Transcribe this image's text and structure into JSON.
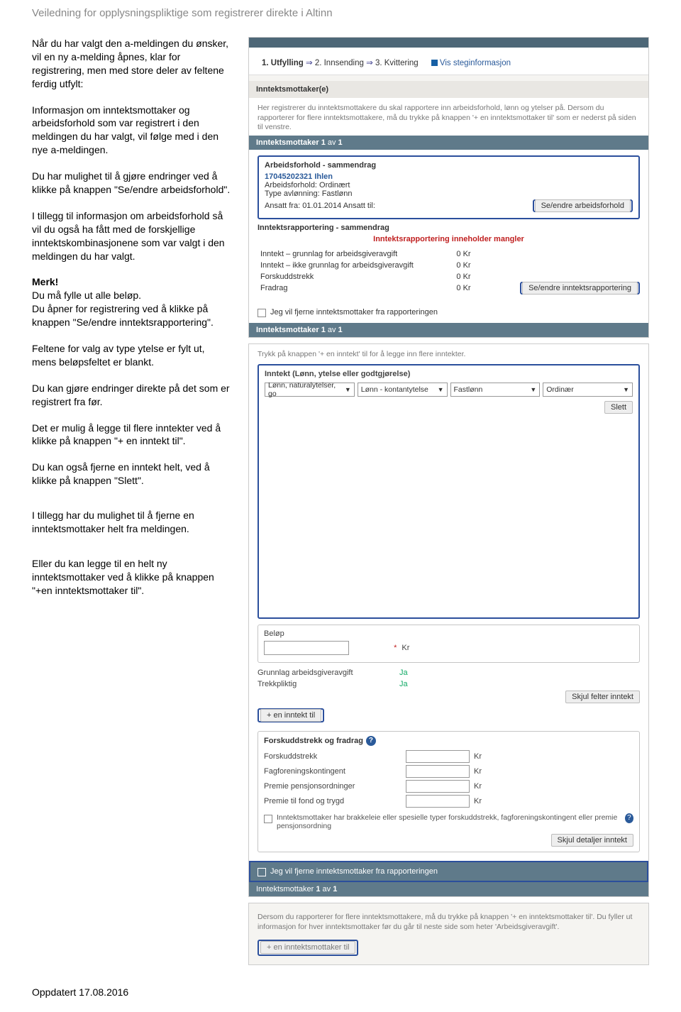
{
  "page_header": "Veiledning for opplysningspliktige som registrerer direkte i Altinn",
  "left": {
    "p1": "Når du har valgt den a-meldingen du ønsker, vil en ny a-melding åpnes, klar for registrering, men med store deler av feltene ferdig utfylt:",
    "p2": "Informasjon om inntektsmottaker og arbeidsforhold som var registrert i den meldingen du har valgt, vil følge med i den nye a-meldingen.",
    "p3": "Du har mulighet til å gjøre endringer ved å klikke på knappen \"Se/endre arbeidsforhold\".",
    "p4": "I tillegg til informasjon om arbeidsforhold så vil du også ha fått med de forskjellige inntektskombinasjonene som var valgt i den meldingen du har valgt.",
    "merk_label": "Merk!",
    "merk1": "Du må fylle ut alle beløp.",
    "merk2": "Du åpner for registrering ved å klikke på knappen \"Se/endre inntektsrapportering\".",
    "p5": "Feltene for valg av type ytelse er fylt ut, mens beløpsfeltet er blankt.",
    "p6": "Du kan gjøre endringer direkte på det som er registrert fra før.",
    "p7": "Det er mulig å legge til flere inntekter ved å klikke på knappen \"+ en inntekt til\".",
    "p8": "Du kan også fjerne en inntekt helt, ved å klikke på knappen \"Slett\".",
    "p9": "I tillegg har du mulighet til å fjerne en inntektsmottaker helt fra meldingen.",
    "p10": "Eller du kan legge til en helt ny inntektsmottaker ved å klikke på knappen \"+en inntektsmottaker til\"."
  },
  "panel1": {
    "step1": "1. Utfylling",
    "step2": "2. Innsending",
    "step3": "3. Kvittering",
    "steglink": "Vis steginformasjon",
    "section_title": "Inntektsmottaker(e)",
    "intro": "Her registrerer du inntektsmottakere du skal rapportere inn arbeidsforhold, lønn og ytelser på. Dersom du rapporterer for flere inntektsmottakere, må du trykke på knappen '+ en inntektsmottaker til' som er nederst på siden til venstre.",
    "subband_top": "Inntektsmottaker 1 av 1",
    "arbeids_title": "Arbeidsforhold - sammendrag",
    "pers_id": "17045202321   Ihlen",
    "arbeidsforhold": "Arbeidsforhold: Ordinært",
    "avlonning": "Type avlønning: Fastlønn",
    "ansatt": "Ansatt fra: 01.01.2014 Ansatt til:",
    "btn_se_arbeid": "Se/endre arbeidsforhold",
    "rapp_title": "Inntektsrapportering - sammendrag",
    "warn": "Inntektsrapportering inneholder mangler",
    "btn_se_rapp": "Se/endre inntektsrapportering",
    "sum": [
      {
        "k": "Inntekt – grunnlag for arbeidsgiveravgift",
        "v": "0 Kr"
      },
      {
        "k": "Inntekt – ikke grunnlag for arbeidsgiveravgift",
        "v": "0 Kr"
      },
      {
        "k": "Forskuddstrekk",
        "v": "0 Kr"
      },
      {
        "k": "Fradrag",
        "v": "0 Kr"
      }
    ],
    "cb_text": "Jeg vil fjerne inntektsmottaker fra rapporteringen",
    "subband_bottom": "Inntektsmottaker 1 av 1"
  },
  "panel2": {
    "tip": "Trykk på knappen '+ en inntekt' til for å legge inn flere inntekter.",
    "legend": "Inntekt (Lønn, ytelse eller godtgjørelse)",
    "sel1": "Lønn, naturalytelser, go",
    "sel2": "Lønn - kontantytelse",
    "sel3": "Fastlønn",
    "sel4": "Ordinær",
    "slett": "Slett",
    "belop_label": "Beløp",
    "kr": "Kr",
    "grunnlag_label": "Grunnlag arbeidsgiveravgift",
    "grunnlag_val": "Ja",
    "trekk_label": "Trekkpliktig",
    "trekk_val": "Ja",
    "skjul_inntekt": "Skjul felter inntekt",
    "add_inntekt": "+ en inntekt til",
    "fors_title": "Forskuddstrekk og fradrag",
    "rows": [
      "Forskuddstrekk",
      "Fagforeningskontingent",
      "Premie pensjonsordninger",
      "Premie til fond og trygd"
    ],
    "longtext": "Inntektsmottaker har brakkeleie eller spesielle typer forskuddstrekk, fagforeningskontingent eller premie pensjonsordning",
    "skjul_detaljer": "Skjul detaljer inntekt",
    "fjern_cb": "Jeg vil fjerne inntektsmottaker fra rapporteringen",
    "footer_sub": "Inntektsmottaker 1 av 1"
  },
  "bottom": {
    "hint": "Dersom du rapporterer for flere inntektsmottakere, må du trykke på knappen '+ en inntektsmottaker til'. Du fyller ut informasjon for hver inntektsmottaker før du går til neste side som heter 'Arbeidsgiveravgift'.",
    "add_btn": "+ en inntektsmottaker til"
  },
  "updated": "Oppdatert  17.08.2016"
}
